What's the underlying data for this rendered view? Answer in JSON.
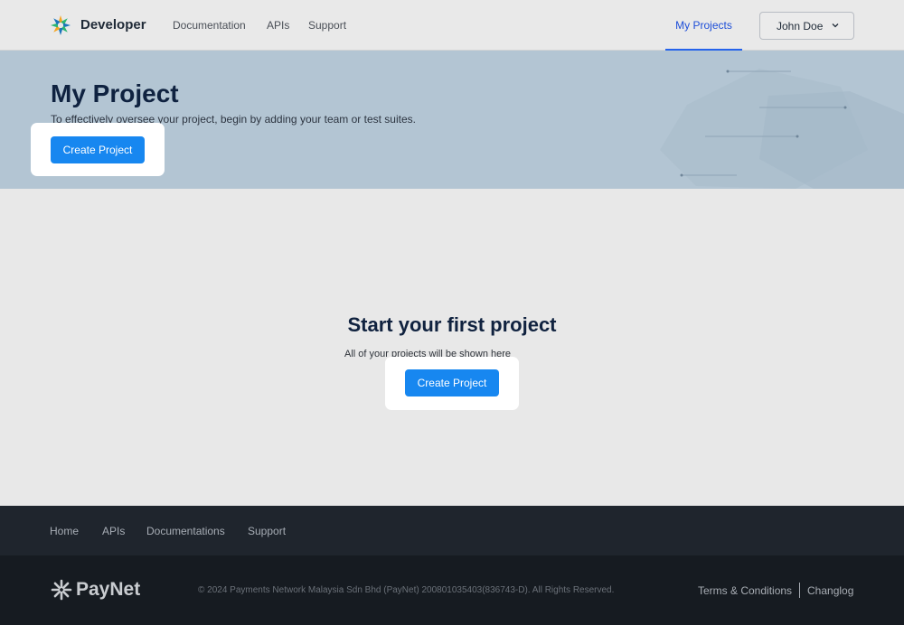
{
  "header": {
    "brand": "Developer",
    "nav": [
      "Documentation",
      "APIs",
      "Support"
    ],
    "my_projects": "My Projects",
    "user": "John Doe"
  },
  "hero": {
    "title": "My Project",
    "subtitle": "To effectively oversee your project, begin by adding your team or test suites.",
    "button": "Create Project"
  },
  "empty_state": {
    "title": "Start your first project",
    "subtitle": "All of your projects will be shown here",
    "button": "Create Project"
  },
  "footer": {
    "nav": [
      "Home",
      "APIs",
      "Documentations",
      "Support"
    ],
    "brand": "PayNet",
    "copyright": "© 2024 Payments Network Malaysia Sdn Bhd (PayNet) 200801035403(836743-D). All Rights Reserved.",
    "links": [
      "Terms & Conditions",
      "Changlog"
    ]
  },
  "colors": {
    "primary": "#1787f0",
    "active_tab": "#1d4ed8",
    "hero_bg": "#b3c5d3",
    "footer_bg": "#161b21"
  },
  "icons": [
    "developer-logo-icon",
    "chevron-down-icon",
    "paynet-logo-icon"
  ]
}
